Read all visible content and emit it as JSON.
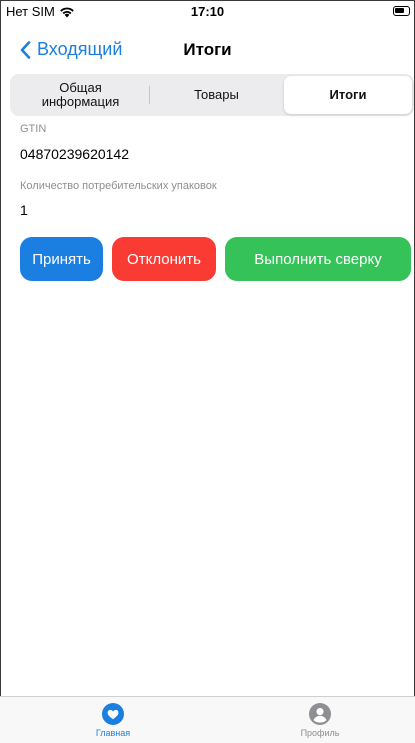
{
  "status_bar": {
    "carrier": "Нет SIM",
    "time": "17:10",
    "icons": [
      "wifi-icon",
      "battery-icon"
    ]
  },
  "nav": {
    "back_label": "Входящий",
    "back_icon": "chevron-left-icon",
    "title": "Итоги"
  },
  "segments": {
    "items": [
      "Общая\nинформация",
      "Товары",
      "Итоги"
    ],
    "selected": "Итоги"
  },
  "fields": [
    {
      "label": "GTIN",
      "value": "04870239620142"
    },
    {
      "label": "Количество потребительских упаковок",
      "value": "1"
    }
  ],
  "actions": {
    "accept": "Принять",
    "reject": "Отклонить",
    "reconcile": "Выполнить сверку"
  },
  "tab_bar": {
    "items": [
      {
        "label": "Главная",
        "icon": "heart-icon",
        "active": true
      },
      {
        "label": "Профиль",
        "icon": "profile-icon",
        "active": false
      }
    ]
  },
  "colors": {
    "accent": "#1a7fe0",
    "accept": "#1a7fe0",
    "reject": "#fa3b33",
    "reconcile": "#34c259",
    "inactive": "#8e8e93"
  }
}
